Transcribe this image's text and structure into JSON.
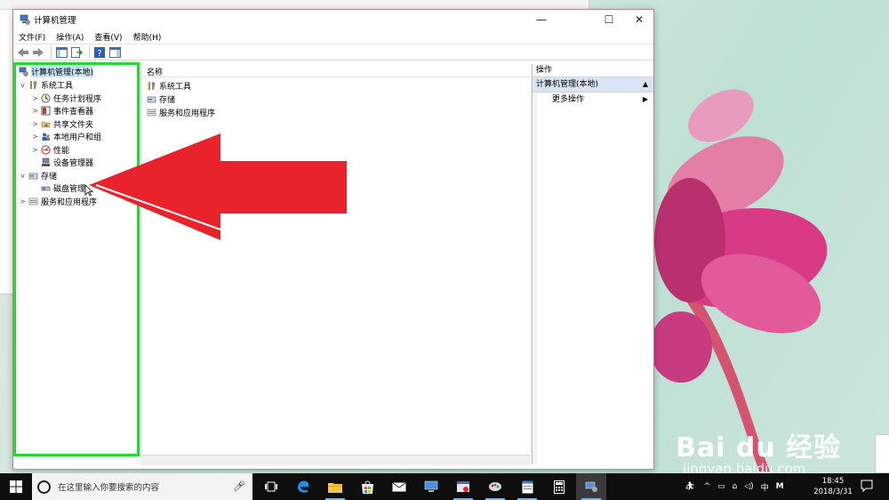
{
  "window": {
    "title": "计算机管理",
    "controls": {
      "minimize": "—",
      "maximize": "☐",
      "close": "✕"
    }
  },
  "menu": [
    "文件(F)",
    "操作(A)",
    "查看(V)",
    "帮助(H)"
  ],
  "tree": {
    "root": "计算机管理(本地)",
    "items": [
      {
        "label": "系统工具",
        "expander": "v",
        "icon": "tools-icon"
      },
      {
        "label": "任务计划程序",
        "expander": ">",
        "icon": "clock-icon"
      },
      {
        "label": "事件查看器",
        "expander": ">",
        "icon": "event-viewer-icon"
      },
      {
        "label": "共享文件夹",
        "expander": ">",
        "icon": "shared-folder-icon"
      },
      {
        "label": "本地用户和组",
        "expander": ">",
        "icon": "users-icon"
      },
      {
        "label": "性能",
        "expander": ">",
        "icon": "performance-icon"
      },
      {
        "label": "设备管理器",
        "expander": "",
        "icon": "device-manager-icon"
      },
      {
        "label": "存储",
        "expander": "v",
        "icon": "storage-icon"
      },
      {
        "label": "磁盘管理",
        "expander": "",
        "icon": "disk-icon"
      },
      {
        "label": "服务和应用程序",
        "expander": ">",
        "icon": "services-icon"
      }
    ]
  },
  "list": {
    "column": "名称",
    "rows": [
      "系统工具",
      "存储",
      "服务和应用程序"
    ]
  },
  "actions": {
    "header": "操作",
    "section": "计算机管理(本地)",
    "item": "更多操作"
  },
  "taskbar": {
    "search_placeholder": "在这里输入你要搜索的内容",
    "ime": "中",
    "ime_mode": "M",
    "time": "18:45",
    "date": "2018/3/31"
  },
  "watermark": {
    "brand": "Bai du 经验",
    "url": "jingyan.baidu.com"
  },
  "colors": {
    "highlight_box": "#27d53a",
    "arrow": "#e8232b",
    "taskbar": "#0e0e0e"
  }
}
